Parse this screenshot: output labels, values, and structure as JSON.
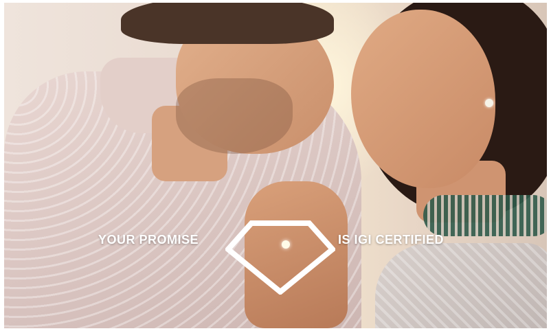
{
  "banner": {
    "tagline_left": "YOUR PROMISE",
    "tagline_right": "IS IGI CERTIFIED",
    "logo_shape": "diamond-outline-icon",
    "text_color": "#ffffff"
  }
}
